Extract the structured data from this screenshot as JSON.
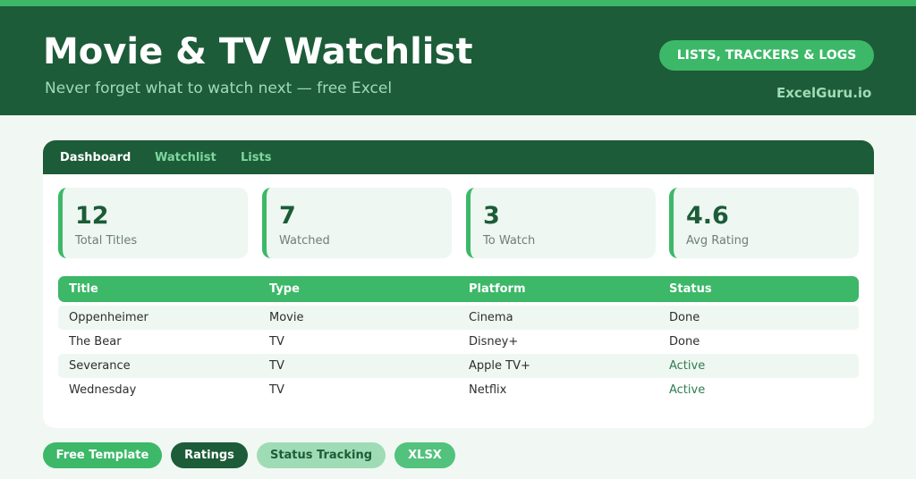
{
  "header": {
    "title": "Movie & TV Watchlist",
    "subtitle": "Never forget what to watch next — free Excel",
    "badge": "LISTS, TRACKERS & LOGS",
    "brand": "ExcelGuru.io"
  },
  "tabs": [
    {
      "label": "Dashboard",
      "active": true
    },
    {
      "label": "Watchlist",
      "active": false
    },
    {
      "label": "Lists",
      "active": false
    }
  ],
  "stats": [
    {
      "value": "12",
      "label": "Total Titles"
    },
    {
      "value": "7",
      "label": "Watched"
    },
    {
      "value": "3",
      "label": "To Watch"
    },
    {
      "value": "4.6",
      "label": "Avg Rating"
    }
  ],
  "table": {
    "headers": [
      "Title",
      "Type",
      "Platform",
      "Status"
    ],
    "rows": [
      [
        "Oppenheimer",
        "Movie",
        "Cinema",
        "Done"
      ],
      [
        "The Bear",
        "TV",
        "Disney+",
        "Done"
      ],
      [
        "Severance",
        "TV",
        "Apple TV+",
        "Active"
      ],
      [
        "Wednesday",
        "TV",
        "Netflix",
        "Active"
      ]
    ]
  },
  "chips": [
    {
      "label": "Free Template"
    },
    {
      "label": "Ratings"
    },
    {
      "label": "Status Tracking"
    },
    {
      "label": "XLSX"
    }
  ],
  "colors": {
    "dark_green": "#1c5c38",
    "accent_green": "#3cb868",
    "light_green": "#9fdcb6",
    "pale_bg": "#f1f8f3"
  }
}
